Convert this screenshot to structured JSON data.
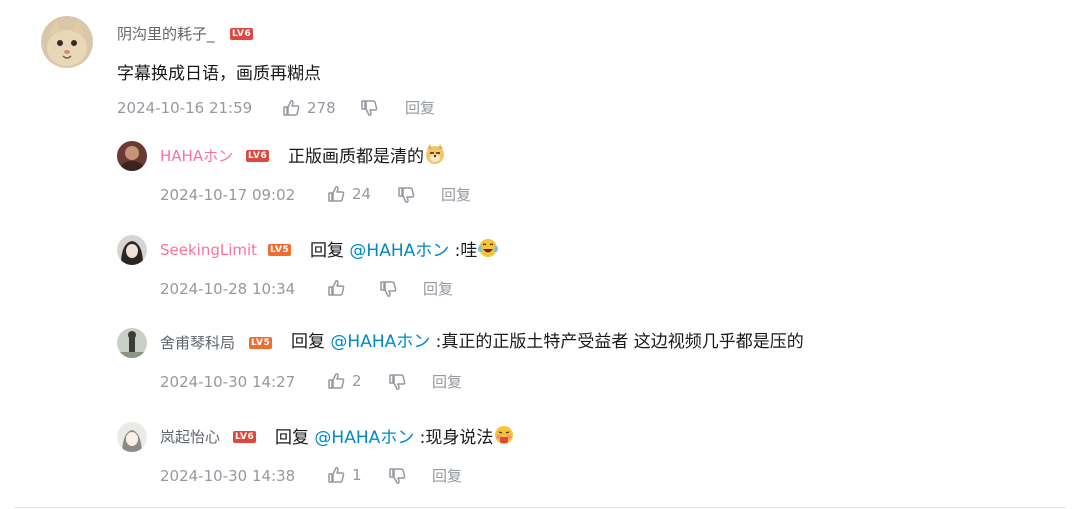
{
  "comment": {
    "user": "阴沟里的耗子_",
    "level": "LV6",
    "text": "字幕换成日语，画质再糊点",
    "time": "2024-10-16 21:59",
    "likes": "278",
    "reply_label": "回复"
  },
  "replies": [
    {
      "user": "HAHAホン",
      "level": "LV6",
      "text": "正版画质都是清的",
      "time": "2024-10-17 09:02",
      "likes": "24",
      "reply_label": "回复",
      "emoji": "doge-emoji"
    },
    {
      "user": "SeekingLimit",
      "level": "LV5",
      "prefix": "回复",
      "mention": "@HAHAホン",
      "text": ":哇",
      "time": "2024-10-28 10:34",
      "likes": "",
      "reply_label": "回复",
      "emoji": "laughing-tears-emoji"
    },
    {
      "user": "舍甫琴科局",
      "level": "LV5",
      "prefix": "回复",
      "mention": "@HAHAホン",
      "text": ":真正的正版土特产受益者 这边视频几乎都是压的",
      "time": "2024-10-30 14:27",
      "likes": "2",
      "reply_label": "回复"
    },
    {
      "user": "岚起怡心",
      "level": "LV6",
      "prefix": "回复",
      "mention": "@HAHAホン",
      "text": ":现身说法",
      "time": "2024-10-30 14:38",
      "likes": "1",
      "reply_label": "回复",
      "emoji": "blushing-face-emoji"
    }
  ],
  "colors": {
    "username_normal": "#61666d",
    "username_vip": "#fb7299",
    "mention": "#008ac5",
    "meta": "#9499a0",
    "level6": "#e0483f",
    "level5": "#f06d32"
  }
}
